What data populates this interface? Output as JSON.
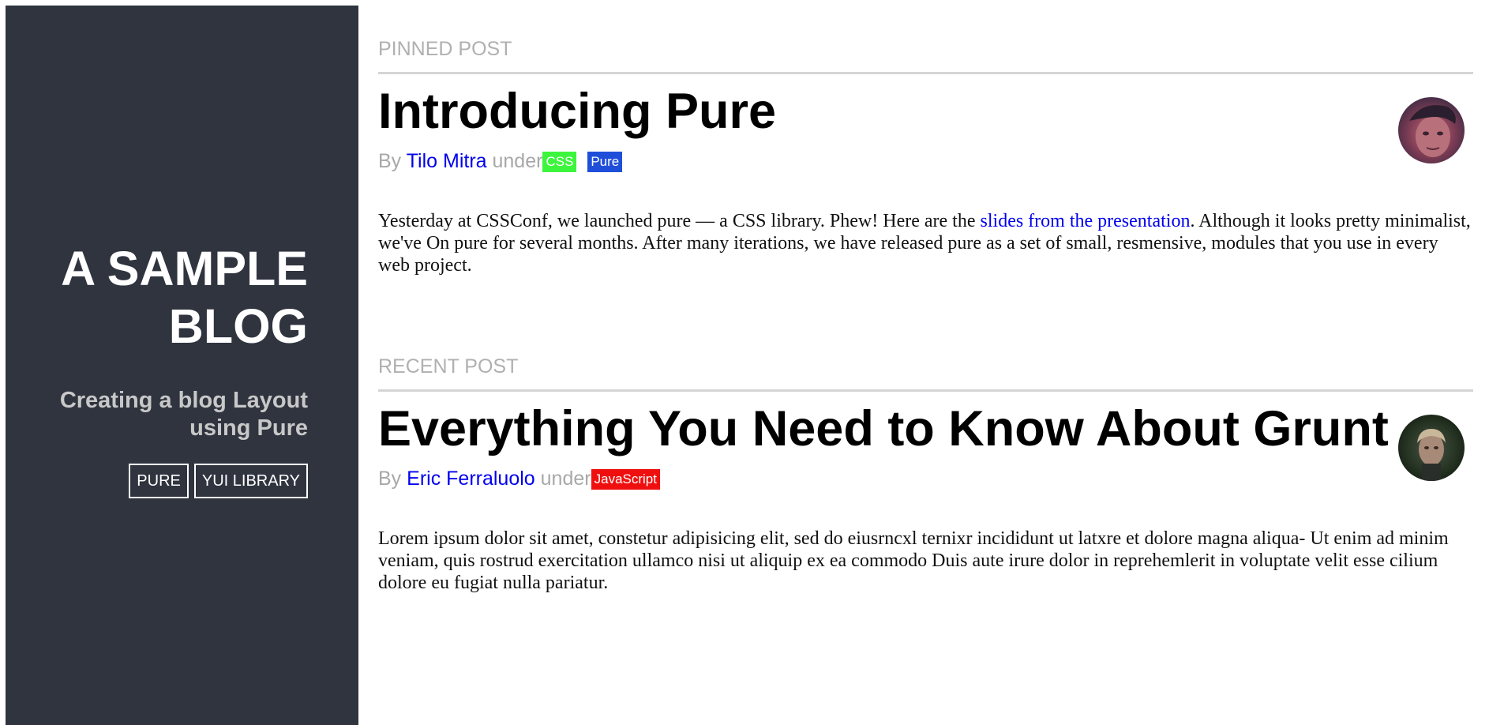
{
  "sidebar": {
    "title": "A Sample Blog",
    "tagline": "Creating a blog Layout using Pure",
    "nav": [
      {
        "label": "Pure"
      },
      {
        "label": "YUI Library"
      }
    ]
  },
  "sections": {
    "pinned": {
      "heading": "Pinned Post",
      "post": {
        "title": "Introducing Pure",
        "by": "By",
        "author": "Tilo Mitra",
        "under": "under",
        "tags": [
          {
            "label": "CSS",
            "color": "#3df53d"
          },
          {
            "label": "Pure",
            "color": "#1f4fd9"
          }
        ],
        "body_before": "Yesterday at CSSConf, we launched pure — a CSS library. Phew! Here are the ",
        "body_link": "slides from the presentation",
        "body_after": ". Although it looks pretty minimalist, we've On pure for several months. After many iterations, we have released pure as a set of small, resmensive, modules that you use in every web project."
      }
    },
    "recent": {
      "heading": "Recent Post",
      "post": {
        "title": "Everything You Need to Know About Grunt",
        "by": "By",
        "author": "Eric Ferraluolo",
        "under": "under",
        "tags": [
          {
            "label": "JavaScript",
            "color": "#f00f0f"
          }
        ],
        "body": "Lorem ipsum dolor sit amet, constetur adipisicing elit, sed do eiusrncxl ternixr incididunt ut latxre et dolore magna aliqua- Ut enim ad minim veniam, quis rostrud exercitation ullamco nisi ut aliquip ex ea commodo Duis aute irure dolor in reprehemlerit in voluptate velit esse cilium dolore eu fugiat nulla pariatur."
      }
    }
  },
  "colors": {
    "sidebar_bg": "#2f343f",
    "link": "#0000ee",
    "muted": "#a8a8a8"
  }
}
